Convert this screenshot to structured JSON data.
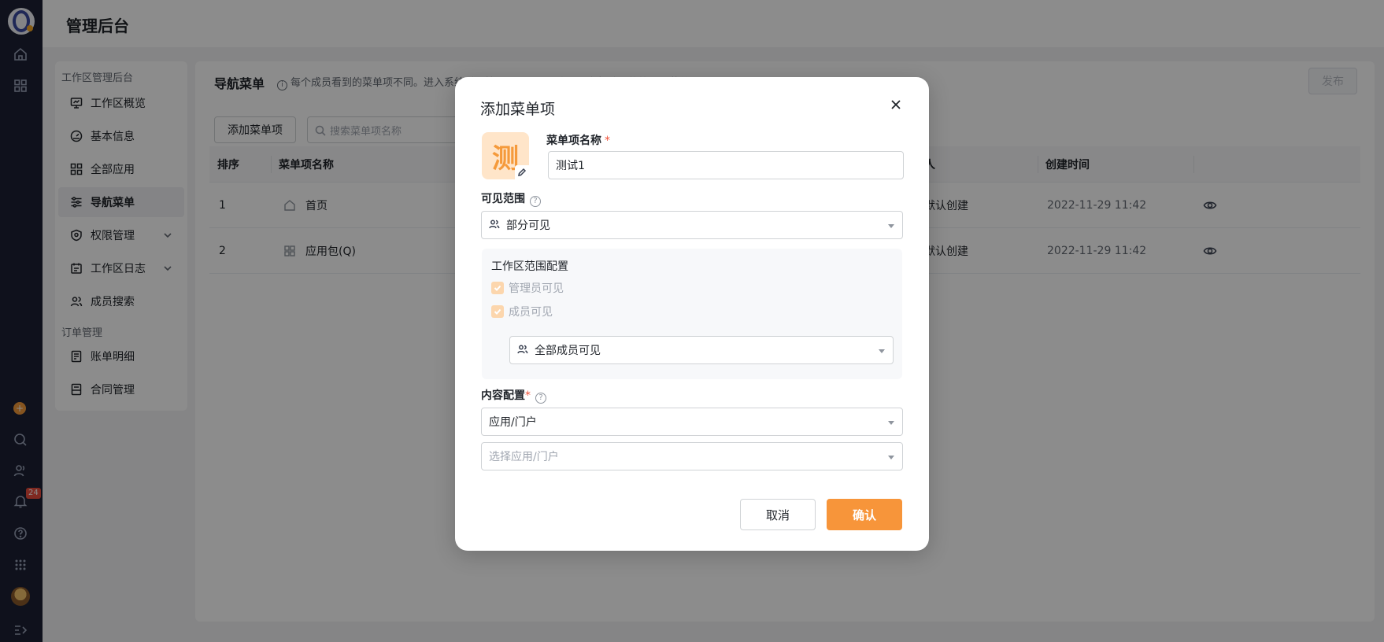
{
  "app": {
    "title": "管理后台",
    "notification_count": "24"
  },
  "rail_icons": [
    "home-icon",
    "apps-grid-icon",
    "add-icon",
    "search-icon",
    "contacts-icon",
    "bell-icon",
    "help-icon",
    "dots-grid-icon",
    "avatar",
    "collapse-icon"
  ],
  "sidebar": {
    "group1": "工作区管理后台",
    "group2": "订单管理",
    "items": [
      {
        "label": "工作区概览",
        "icon": "monitor-icon"
      },
      {
        "label": "基本信息",
        "icon": "gauge-icon"
      },
      {
        "label": "全部应用",
        "icon": "grid-icon"
      },
      {
        "label": "导航菜单",
        "icon": "sliders-icon",
        "active": true
      },
      {
        "label": "权限管理",
        "icon": "shield-icon",
        "expandable": true
      },
      {
        "label": "工作区日志",
        "icon": "calendar-icon",
        "expandable": true
      },
      {
        "label": "成员搜索",
        "icon": "users-icon"
      },
      {
        "label": "账单明细",
        "icon": "bill-icon"
      },
      {
        "label": "合同管理",
        "icon": "contract-icon"
      }
    ]
  },
  "main": {
    "heading": "导航菜单",
    "tip": "每个成员看到的菜单项不同。进入系统时，按照从上至下顺序显示有权访问的第一个菜单项。",
    "publish_label": "发布",
    "add_label": "添加菜单项",
    "search_placeholder": "搜索菜单项名称",
    "columns": [
      "排序",
      "菜单项名称",
      "创建人",
      "创建时间"
    ],
    "rows": [
      {
        "order": "1",
        "name": "首页",
        "creator": "系统默认创建",
        "time": "2022-11-29 11:42"
      },
      {
        "order": "2",
        "name": "应用包(Q)",
        "creator": "系统默认创建",
        "time": "2022-11-29 11:42"
      }
    ]
  },
  "modal": {
    "title": "添加菜单项",
    "icon_char": "测",
    "name_label": "菜单项名称",
    "name_value": "测试1",
    "visibility_label": "可见范围",
    "visibility_value": "部分可见",
    "scope_title": "工作区范围配置",
    "check_admin": "管理员可见",
    "check_member": "成员可见",
    "member_scope_value": "全部成员可见",
    "content_label": "内容配置",
    "content_type_value": "应用/门户",
    "content_select_placeholder": "选择应用/门户",
    "cancel_label": "取消",
    "confirm_label": "确认"
  },
  "colors": {
    "accent": "#f7953a",
    "rail_bg": "#1c2033",
    "required": "#f0523a"
  }
}
